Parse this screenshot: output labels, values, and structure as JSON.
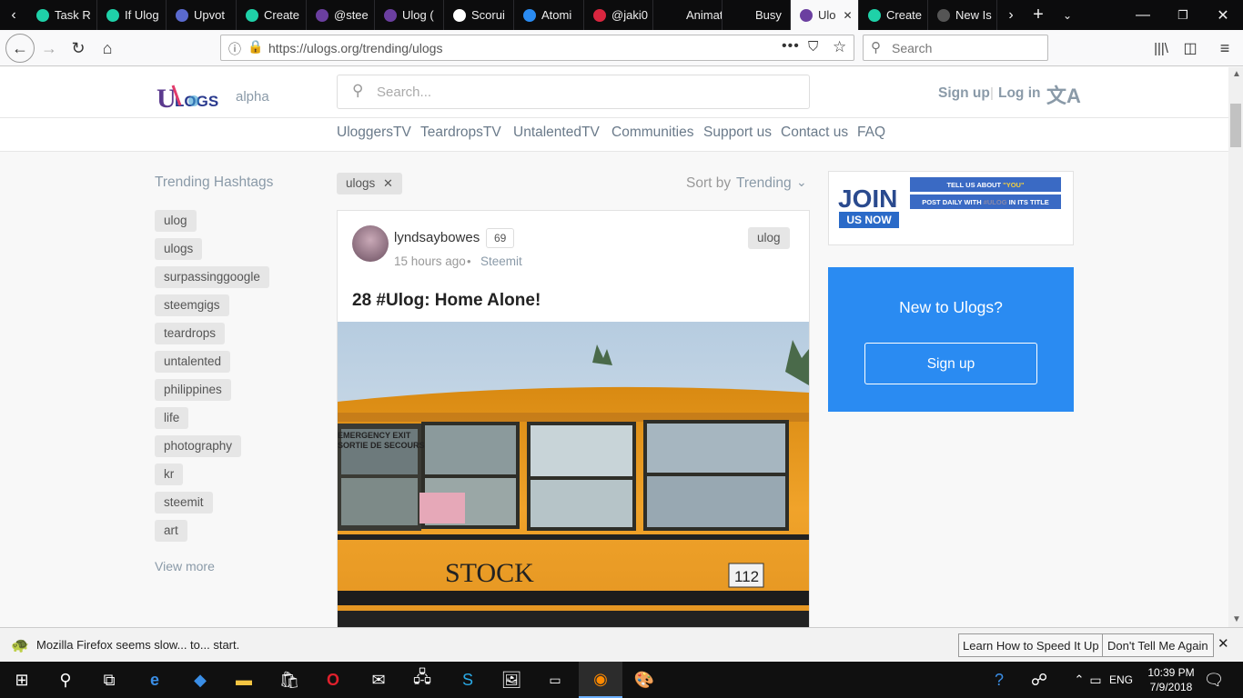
{
  "browser": {
    "tabs": [
      {
        "label": "Task R",
        "color": "#1fd1a8"
      },
      {
        "label": "If Ulog",
        "color": "#1fd1a8"
      },
      {
        "label": "Upvot",
        "color": "#5a6acf"
      },
      {
        "label": "Create",
        "color": "#1fd1a8"
      },
      {
        "label": "@stee",
        "color": "#6b3fa0"
      },
      {
        "label": "Ulog (",
        "color": "#6b3fa0"
      },
      {
        "label": "Scorui",
        "color": "#ffffff"
      },
      {
        "label": "Atomi",
        "color": "#2a8bf2"
      },
      {
        "label": "@jaki0",
        "color": "#d9263f"
      },
      {
        "label": "Animated",
        "color": ""
      },
      {
        "label": "Busy",
        "color": ""
      },
      {
        "label": "Ulo",
        "color": "#6b3fa0"
      },
      {
        "label": "Create",
        "color": "#1fd1a8"
      },
      {
        "label": "New Is",
        "color": "#555555"
      }
    ],
    "active_tab_index": 11,
    "url": "https://ulogs.org/trending/ulogs",
    "url_host": "ulogs.org",
    "search_placeholder": "Search"
  },
  "site": {
    "logo_alpha": "alpha",
    "search_placeholder": "Search...",
    "signup": "Sign up",
    "login": "Log in",
    "nav": [
      "UloggersTV",
      "TeardropsTV",
      "UntalentedTV",
      "Communities",
      "Support us",
      "Contact us",
      "FAQ"
    ]
  },
  "sidebar": {
    "title": "Trending Hashtags",
    "tags": [
      "ulog",
      "ulogs",
      "surpassinggoogle",
      "steemgigs",
      "teardrops",
      "untalented",
      "philippines",
      "life",
      "photography",
      "kr",
      "steemit",
      "art"
    ],
    "view_more": "View more"
  },
  "filter": {
    "tag": "ulogs",
    "sort_label": "Sort by",
    "sort_value": "Trending"
  },
  "post": {
    "author": "lyndsaybowes",
    "reputation": "69",
    "time": "15 hours ago",
    "app": "Steemit",
    "tag": "ulog",
    "title": "28 #Ulog: Home Alone!",
    "image_texts": {
      "exit1": "EMERGENCY EXIT",
      "exit2": "SORTIE DE SECOURS",
      "stock": "STOCK",
      "num": "112"
    }
  },
  "banner": {
    "join": "JOIN",
    "us_now": "US NOW",
    "line1_pre": "TELL US ABOUT ",
    "line1_hl": "\"YOU\"",
    "line2_pre": "POST DAILY WITH ",
    "line2_hl": "#ULOG",
    "line2_post": " IN ITS TITLE"
  },
  "signup_box": {
    "title": "New to Ulogs?",
    "button": "Sign up"
  },
  "notification": {
    "text": "Mozilla Firefox seems slow... to... start.",
    "btn1": "Learn How to Speed It Up",
    "btn2": "Don't Tell Me Again"
  },
  "taskbar": {
    "lang": "ENG",
    "time": "10:39 PM",
    "date": "7/9/2018"
  }
}
